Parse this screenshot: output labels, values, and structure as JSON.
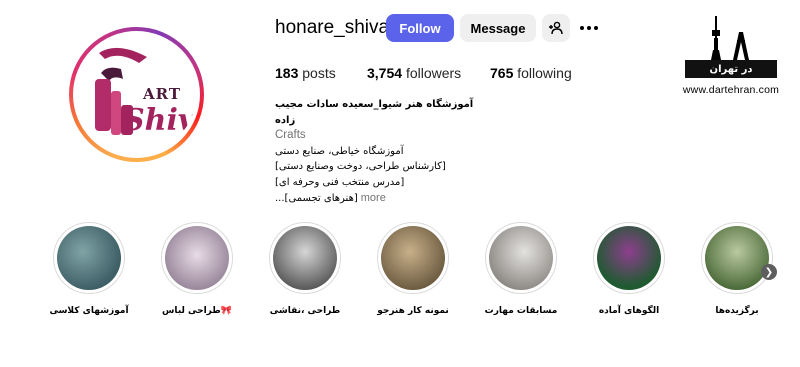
{
  "profile": {
    "username": "honare_shiva",
    "avatar_text_top": "ART",
    "avatar_text_main": "Shiva"
  },
  "actions": {
    "follow_label": "Follow",
    "message_label": "Message",
    "suggest_icon": "add-person-icon",
    "more_icon": "more-horizontal-icon"
  },
  "stats": {
    "posts_count": "183",
    "posts_label": "posts",
    "followers_count": "3,754",
    "followers_label": "followers",
    "following_count": "765",
    "following_label": "following"
  },
  "bio": {
    "name": "آموزشگاه هنر شیوا_سعیده سادات مجیب زاده",
    "category": "Crafts",
    "lines": [
      "آموزشگاه خیاطی، صنایع دستی",
      "[کارشناس طراحی، دوخت وصنایع دستی]",
      "[مدرس منتخب فنی وحرفه ای]",
      "[هنرهای تجسمی]..."
    ],
    "more_label": "more"
  },
  "watermark": {
    "band_text": "در تهران",
    "url": "www.dartehran.com"
  },
  "highlights": [
    {
      "label": "آموزشهای کلاسی",
      "color": "#5f7f86"
    },
    {
      "label": "طراحی لباس🎀",
      "color": "#b7a7b8"
    },
    {
      "label": "طراحی ،نقاشی",
      "color": "#8e8e8e"
    },
    {
      "label": "نمونه کار هنرجو",
      "color": "#8c7a5c"
    },
    {
      "label": "مسابقات مهارت",
      "color": "#a8a6a4"
    },
    {
      "label": "الگوهای آماده",
      "color": "#2e6b3f"
    },
    {
      "label": "برگزیده‌ها",
      "color": "#6f8a56"
    }
  ],
  "colors": {
    "follow_bg": "#5b63ea",
    "secondary_btn_bg": "#efefef",
    "muted_text": "#737373"
  }
}
